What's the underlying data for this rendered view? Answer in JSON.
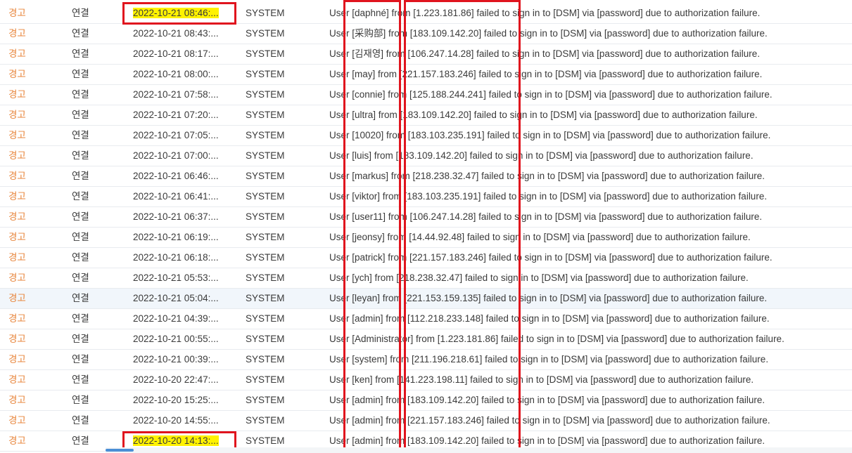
{
  "log": {
    "rows": [
      {
        "level": "경고",
        "category": "연결",
        "time": "2022-10-21 08:46:...",
        "user": "SYSTEM",
        "message": "User [daphné] from [1.223.181.86] failed to sign in to [DSM] via [password] due to authorization failure."
      },
      {
        "level": "경고",
        "category": "연결",
        "time": "2022-10-21 08:43:...",
        "user": "SYSTEM",
        "message": "User [采购部] from [183.109.142.20] failed to sign in to [DSM] via [password] due to authorization failure."
      },
      {
        "level": "경고",
        "category": "연결",
        "time": "2022-10-21 08:17:...",
        "user": "SYSTEM",
        "message": "User [김재영] from [106.247.14.28] failed to sign in to [DSM] via [password] due to authorization failure."
      },
      {
        "level": "경고",
        "category": "연결",
        "time": "2022-10-21 08:00:...",
        "user": "SYSTEM",
        "message": "User [may] from [221.157.183.246] failed to sign in to [DSM] via [password] due to authorization failure."
      },
      {
        "level": "경고",
        "category": "연결",
        "time": "2022-10-21 07:58:...",
        "user": "SYSTEM",
        "message": "User [connie] from [125.188.244.241] failed to sign in to [DSM] via [password] due to authorization failure."
      },
      {
        "level": "경고",
        "category": "연결",
        "time": "2022-10-21 07:20:...",
        "user": "SYSTEM",
        "message": "User [ultra] from [183.109.142.20] failed to sign in to [DSM] via [password] due to authorization failure."
      },
      {
        "level": "경고",
        "category": "연결",
        "time": "2022-10-21 07:05:...",
        "user": "SYSTEM",
        "message": "User [10020] from [183.103.235.191] failed to sign in to [DSM] via [password] due to authorization failure."
      },
      {
        "level": "경고",
        "category": "연결",
        "time": "2022-10-21 07:00:...",
        "user": "SYSTEM",
        "message": "User [luis] from [183.109.142.20] failed to sign in to [DSM] via [password] due to authorization failure."
      },
      {
        "level": "경고",
        "category": "연결",
        "time": "2022-10-21 06:46:...",
        "user": "SYSTEM",
        "message": "User [markus] from [218.238.32.47] failed to sign in to [DSM] via [password] due to authorization failure."
      },
      {
        "level": "경고",
        "category": "연결",
        "time": "2022-10-21 06:41:...",
        "user": "SYSTEM",
        "message": "User [viktor] from [183.103.235.191] failed to sign in to [DSM] via [password] due to authorization failure."
      },
      {
        "level": "경고",
        "category": "연결",
        "time": "2022-10-21 06:37:...",
        "user": "SYSTEM",
        "message": "User [user11] from [106.247.14.28] failed to sign in to [DSM] via [password] due to authorization failure."
      },
      {
        "level": "경고",
        "category": "연결",
        "time": "2022-10-21 06:19:...",
        "user": "SYSTEM",
        "message": "User [jeonsy] from [14.44.92.48] failed to sign in to [DSM] via [password] due to authorization failure."
      },
      {
        "level": "경고",
        "category": "연결",
        "time": "2022-10-21 06:18:...",
        "user": "SYSTEM",
        "message": "User [patrick] from [221.157.183.246] failed to sign in to [DSM] via [password] due to authorization failure."
      },
      {
        "level": "경고",
        "category": "연결",
        "time": "2022-10-21 05:53:...",
        "user": "SYSTEM",
        "message": "User [ych] from [218.238.32.47] failed to sign in to [DSM] via [password] due to authorization failure."
      },
      {
        "level": "경고",
        "category": "연결",
        "time": "2022-10-21 05:04:...",
        "user": "SYSTEM",
        "message": "User [leyan] from [221.153.159.135] failed to sign in to [DSM] via [password] due to authorization failure."
      },
      {
        "level": "경고",
        "category": "연결",
        "time": "2022-10-21 04:39:...",
        "user": "SYSTEM",
        "message": "User [admin] from [112.218.233.148] failed to sign in to [DSM] via [password] due to authorization failure."
      },
      {
        "level": "경고",
        "category": "연결",
        "time": "2022-10-21 00:55:...",
        "user": "SYSTEM",
        "message": "User [Administrator] from [1.223.181.86] failed to sign in to [DSM] via [password] due to authorization failure."
      },
      {
        "level": "경고",
        "category": "연결",
        "time": "2022-10-21 00:39:...",
        "user": "SYSTEM",
        "message": "User [system] from [211.196.218.61] failed to sign in to [DSM] via [password] due to authorization failure."
      },
      {
        "level": "경고",
        "category": "연결",
        "time": "2022-10-20 22:47:...",
        "user": "SYSTEM",
        "message": "User [ken] from [141.223.198.11] failed to sign in to [DSM] via [password] due to authorization failure."
      },
      {
        "level": "경고",
        "category": "연결",
        "time": "2022-10-20 15:25:...",
        "user": "SYSTEM",
        "message": "User [admin] from [183.109.142.20] failed to sign in to [DSM] via [password] due to authorization failure."
      },
      {
        "level": "경고",
        "category": "연결",
        "time": "2022-10-20 14:55:...",
        "user": "SYSTEM",
        "message": "User [admin] from [221.157.183.246] failed to sign in to [DSM] via [password] due to authorization failure."
      },
      {
        "level": "경고",
        "category": "연결",
        "time": "2022-10-20 14:13:...",
        "user": "SYSTEM",
        "message": "User [admin] from [183.109.142.20] failed to sign in to [DSM] via [password] due to authorization failure."
      }
    ],
    "selected_row": 14,
    "highlighted_rows": [
      0,
      21
    ]
  },
  "colors": {
    "warning_level": "#e8853b",
    "highlight": "#fff200",
    "annotation_box": "#e0141e",
    "scroll_thumb": "#4a8fd6"
  }
}
